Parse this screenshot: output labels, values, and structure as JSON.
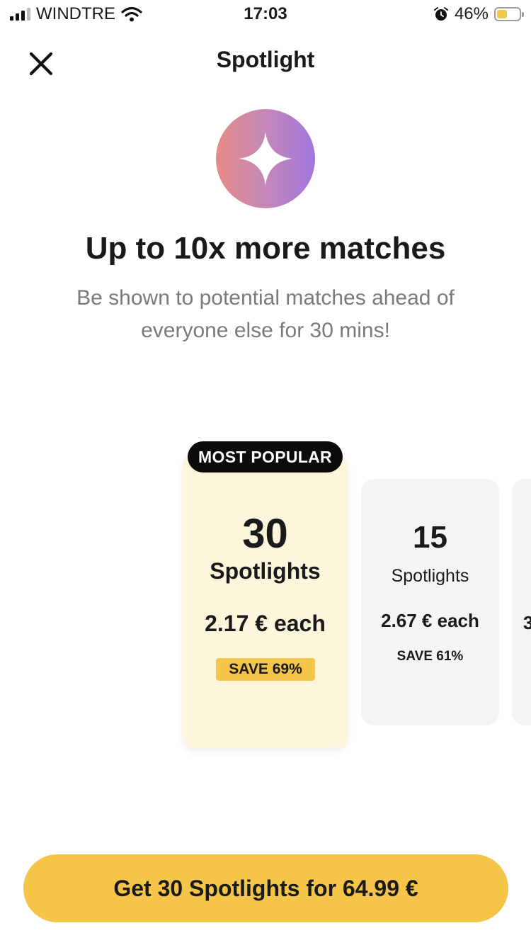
{
  "status_bar": {
    "carrier": "WINDTRE",
    "time": "17:03",
    "battery_percent": "46%",
    "battery_level": 0.46,
    "icons": [
      "signal-icon",
      "wifi-icon",
      "alarm-icon",
      "battery-icon"
    ]
  },
  "header": {
    "title": "Spotlight",
    "close_icon": "close-icon"
  },
  "hero": {
    "icon": "sparkle-icon",
    "headline": "Up to 10x more matches",
    "subtitle": "Be shown to potential matches ahead of everyone else for 30 mins!"
  },
  "packages": [
    {
      "badge": "MOST POPULAR",
      "count": "30",
      "unit": "Spotlights",
      "price": "2.17 € each",
      "save": "SAVE 69%",
      "selected": true
    },
    {
      "count": "15",
      "unit": "Spotlights",
      "price": "2.67 € each",
      "save": "SAVE 61%",
      "selected": false
    },
    {
      "price_fragment": "3",
      "selected": false
    }
  ],
  "cta": {
    "label": "Get 30 Spotlights for 64.99 €"
  },
  "colors": {
    "accent": "#F5C54A",
    "selected_card": "#FDF6DC",
    "unselected_card": "#F4F4F4",
    "badge": "#0B0B0B",
    "gradient_start": "#E68A86",
    "gradient_end": "#9F77DC",
    "subtitle_text": "#7A7A7A"
  }
}
